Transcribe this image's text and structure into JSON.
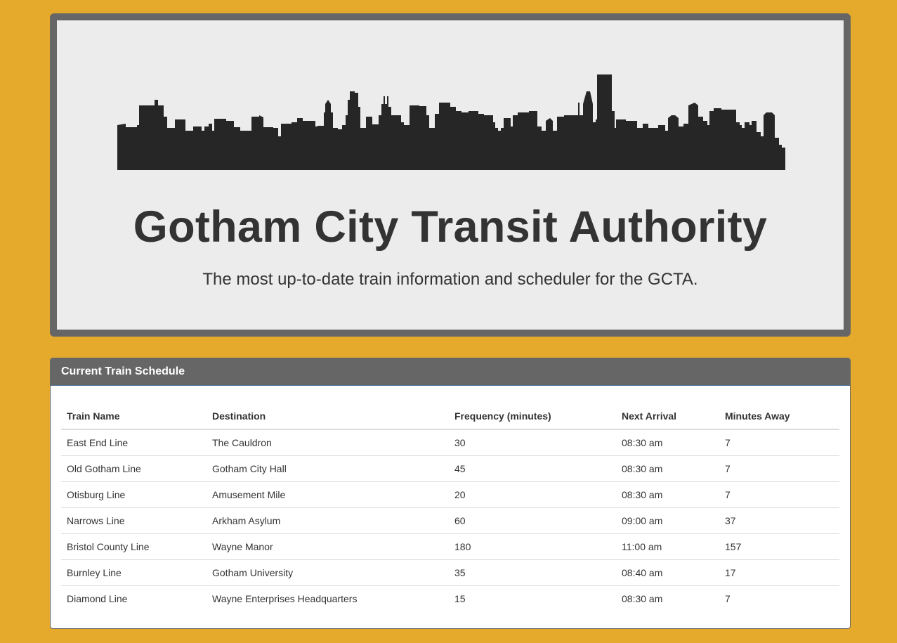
{
  "header": {
    "title": "Gotham City Transit Authority",
    "subtitle": "The most up-to-date train information and scheduler for the GCTA.",
    "logo": "city-skyline-icon"
  },
  "schedule": {
    "heading": "Current Train Schedule",
    "columns": [
      "Train Name",
      "Destination",
      "Frequency (minutes)",
      "Next Arrival",
      "Minutes Away"
    ],
    "rows": [
      [
        "East End Line",
        "The Cauldron",
        "30",
        "08:30 am",
        "7"
      ],
      [
        "Old Gotham Line",
        "Gotham City Hall",
        "45",
        "08:30 am",
        "7"
      ],
      [
        "Otisburg Line",
        "Amusement Mile",
        "20",
        "08:30 am",
        "7"
      ],
      [
        "Narrows Line",
        "Arkham Asylum",
        "60",
        "09:00 am",
        "37"
      ],
      [
        "Bristol County Line",
        "Wayne Manor",
        "180",
        "11:00 am",
        "157"
      ],
      [
        "Burnley Line",
        "Gotham University",
        "35",
        "08:40 am",
        "17"
      ],
      [
        "Diamond Line",
        "Wayne Enterprises Headquarters",
        "15",
        "08:30 am",
        "7"
      ]
    ]
  },
  "colors": {
    "background": "#E5AA2B",
    "panel_border": "#666666",
    "jumbotron_bg": "#ECECEC",
    "skyline": "#262626"
  }
}
